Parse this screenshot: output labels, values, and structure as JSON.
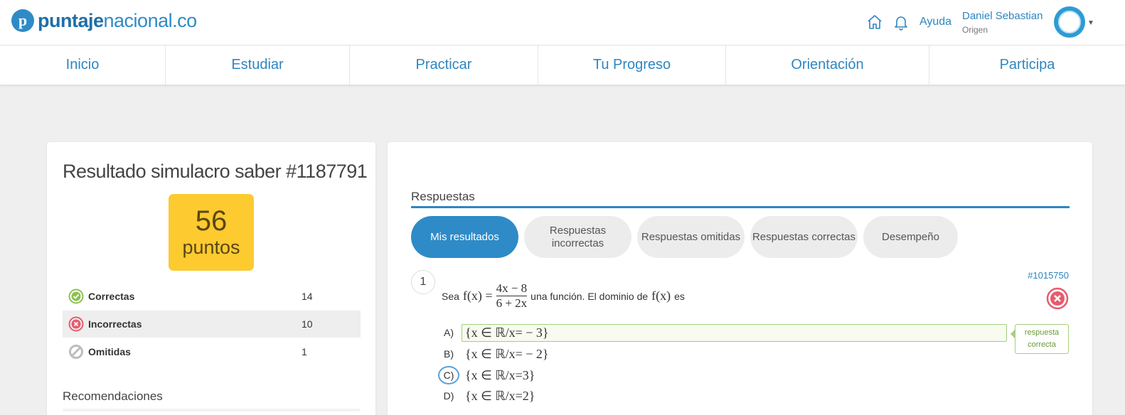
{
  "header": {
    "logo_bold": "puntaje",
    "logo_light": "nacional.co",
    "logo_mark": "p",
    "help_label": "Ayuda",
    "user_name": "Daniel Sebastian",
    "user_level": "Origen",
    "icons": [
      "home-icon",
      "bell-icon",
      "chevron-down-icon"
    ]
  },
  "nav": {
    "items": [
      {
        "label": "Inicio"
      },
      {
        "label": "Estudiar"
      },
      {
        "label": "Practicar"
      },
      {
        "label": "Tu Progreso"
      },
      {
        "label": "Orientación"
      },
      {
        "label": "Participa"
      }
    ]
  },
  "result": {
    "title": "Resultado simulacro saber #1187791",
    "score": "56",
    "score_unit": "puntos",
    "stats": [
      {
        "label": "Correctas",
        "value": "14",
        "icon": "check-circle-icon",
        "color": "#8cc152"
      },
      {
        "label": "Incorrectas",
        "value": "10",
        "icon": "x-circle-icon",
        "color": "#e65c6c"
      },
      {
        "label": "Omitidas",
        "value": "1",
        "icon": "slash-circle-icon",
        "color": "#bdbdbd"
      }
    ],
    "recommendations_title": "Recomendaciones"
  },
  "answers": {
    "title": "Respuestas",
    "tabs": [
      {
        "label": "Mis resultados",
        "active": true
      },
      {
        "label": "Respuestas incorrectas",
        "active": false
      },
      {
        "label": "Respuestas omitidas",
        "active": false
      },
      {
        "label": "Respuestas correctas",
        "active": false
      },
      {
        "label": "Desempeño",
        "active": false
      }
    ],
    "question": {
      "number": "1",
      "id": "#1015750",
      "text_before": "Sea",
      "func": "f(x) =",
      "numerator": "4x − 8",
      "denominator": "6 + 2x",
      "text_middle": "una función. El dominio de",
      "func2": "f(x)",
      "text_after": "es",
      "status_icon": "wrong-answer-icon",
      "options": [
        {
          "letter": "A)",
          "text": "{x ∈ ℝ/x= − 3}",
          "correct": true,
          "selected": false
        },
        {
          "letter": "B)",
          "text": "{x ∈ ℝ/x= − 2}",
          "correct": false,
          "selected": false
        },
        {
          "letter": "C)",
          "text": "{x ∈ ℝ/x=3}",
          "correct": false,
          "selected": true
        },
        {
          "letter": "D)",
          "text": "{x ∈ ℝ/x=2}",
          "correct": false,
          "selected": false
        }
      ],
      "correct_tag": "respuesta correcta"
    }
  },
  "colors": {
    "brand_blue": "#2e8bc7",
    "score_yellow": "#fdca30",
    "correct_green": "#a6cf7b",
    "wrong_red": "#e65c6c"
  }
}
